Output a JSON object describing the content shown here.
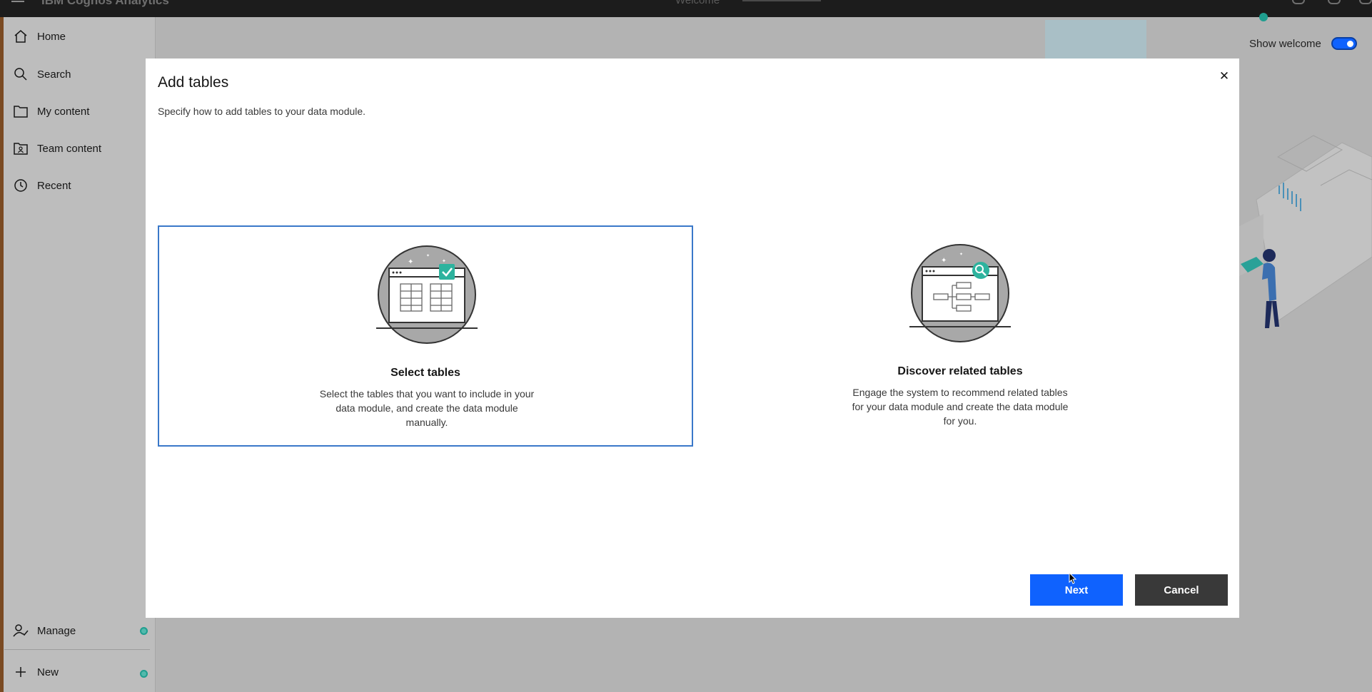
{
  "topbar": {
    "brand": "IBM Cognos Analytics",
    "center_tab": "Welcome"
  },
  "sidebar": {
    "items": [
      {
        "label": "Home",
        "icon": "home-icon"
      },
      {
        "label": "Search",
        "icon": "search-icon"
      },
      {
        "label": "My content",
        "icon": "folder-icon"
      },
      {
        "label": "Team content",
        "icon": "team-folder-icon"
      },
      {
        "label": "Recent",
        "icon": "clock-icon"
      }
    ],
    "bottom": [
      {
        "label": "Manage",
        "icon": "manage-icon"
      },
      {
        "label": "New",
        "icon": "plus-icon"
      }
    ]
  },
  "welcome": {
    "show_welcome_label": "Show welcome",
    "show_welcome_on": true
  },
  "modal": {
    "title": "Add tables",
    "subtitle": "Specify how to add tables to your data module.",
    "options": [
      {
        "title": "Select tables",
        "desc": "Select the tables that you want to include in your data module, and create the data module manually.",
        "selected": true,
        "icon": "table-select-illustration"
      },
      {
        "title": "Discover related tables",
        "desc": "Engage the system to recommend related tables for your data module and create the data module for you.",
        "selected": false,
        "icon": "discover-tables-illustration"
      }
    ],
    "next_label": "Next",
    "cancel_label": "Cancel"
  },
  "colors": {
    "primary": "#0f62fe",
    "teal_accent": "#1f9e8f",
    "cancel_bg": "#393939",
    "selected_border": "#3a78c9"
  }
}
